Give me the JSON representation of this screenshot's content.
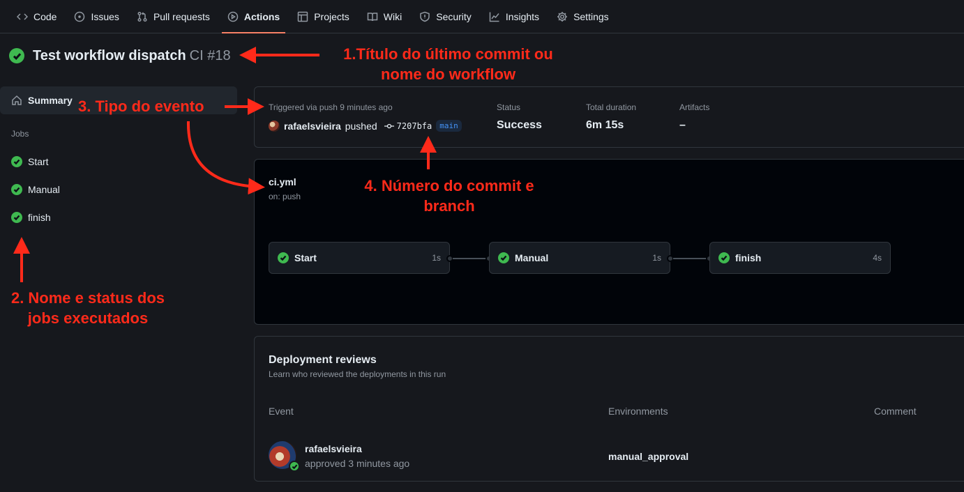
{
  "nav": {
    "tabs": [
      {
        "label": "Code",
        "icon": "code-icon"
      },
      {
        "label": "Issues",
        "icon": "issue-icon"
      },
      {
        "label": "Pull requests",
        "icon": "pull-request-icon"
      },
      {
        "label": "Actions",
        "icon": "play-icon",
        "active": true
      },
      {
        "label": "Projects",
        "icon": "table-icon"
      },
      {
        "label": "Wiki",
        "icon": "book-icon"
      },
      {
        "label": "Security",
        "icon": "shield-icon"
      },
      {
        "label": "Insights",
        "icon": "graph-icon"
      },
      {
        "label": "Settings",
        "icon": "gear-icon"
      }
    ]
  },
  "run": {
    "title": "Test workflow dispatch",
    "workflow_run": "CI #18",
    "status_icon": "check-circle-icon"
  },
  "sidebar": {
    "summary_label": "Summary",
    "jobs_label": "Jobs",
    "jobs": [
      {
        "name": "Start",
        "status": "success"
      },
      {
        "name": "Manual",
        "status": "success"
      },
      {
        "name": "finish",
        "status": "success"
      }
    ]
  },
  "summary": {
    "trigger": "Triggered via push 9 minutes ago",
    "actor": "rafaelsvieira",
    "action": "pushed",
    "commit": "7207bfa",
    "branch": "main",
    "status_label": "Status",
    "status_value": "Success",
    "duration_label": "Total duration",
    "duration_value": "6m 15s",
    "artifacts_label": "Artifacts",
    "artifacts_value": "–"
  },
  "workflow": {
    "file": "ci.yml",
    "on": "on: push",
    "jobs": [
      {
        "name": "Start",
        "duration": "1s"
      },
      {
        "name": "Manual",
        "duration": "1s"
      },
      {
        "name": "finish",
        "duration": "4s"
      }
    ]
  },
  "deployment": {
    "title": "Deployment reviews",
    "subtitle": "Learn who reviewed the deployments in this run",
    "columns": [
      "Event",
      "Environments",
      "Comment"
    ],
    "reviewer": "rafaelsvieira",
    "review_action": "approved 3 minutes ago",
    "environment": "manual_approval"
  },
  "annotations": {
    "a1_line1": "1.Título do último commit ou",
    "a1_line2": "nome do workflow",
    "a2_line1": "2. Nome e status dos",
    "a2_line2": "jobs executados",
    "a3": "3. Tipo do evento",
    "a4_line1": "4. Número do commit e",
    "a4_line2": "branch",
    "color": "#ff2a1a"
  },
  "colors": {
    "success": "#3fb950",
    "accent_tab": "#f78166",
    "branch_text": "#4493f8"
  }
}
